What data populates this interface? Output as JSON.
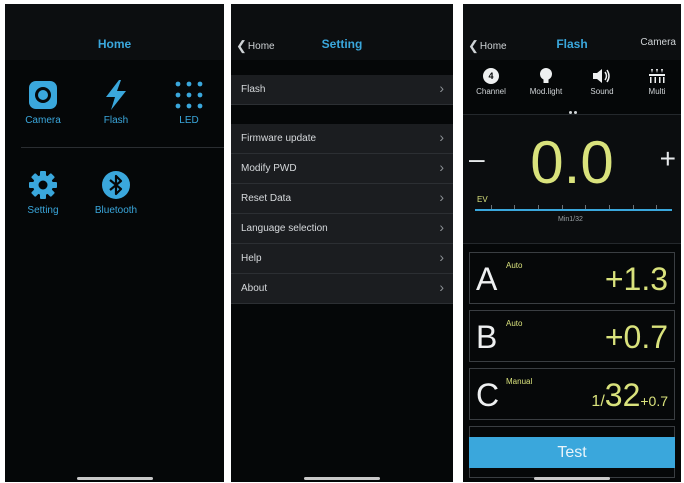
{
  "screen_home": {
    "title": "Home",
    "tiles": [
      {
        "label": "Camera",
        "icon": "camera-icon"
      },
      {
        "label": "Flash",
        "icon": "flash-icon"
      },
      {
        "label": "LED",
        "icon": "led-grid-icon"
      },
      {
        "label": "Setting",
        "icon": "gear-icon"
      },
      {
        "label": "Bluetooth",
        "icon": "bluetooth-icon"
      }
    ]
  },
  "screen_setting": {
    "back_label": "Home",
    "title": "Setting",
    "items": [
      {
        "label": "Flash"
      },
      {
        "label": "Firmware update"
      },
      {
        "label": "Modify PWD"
      },
      {
        "label": "Reset Data"
      },
      {
        "label": "Language selection"
      },
      {
        "label": "Help"
      },
      {
        "label": "About"
      }
    ]
  },
  "screen_flash": {
    "back_label": "Home",
    "title": "Flash",
    "right_label": "Camera",
    "modes": [
      {
        "label": "Channel",
        "badge": "4",
        "icon": "channel-icon"
      },
      {
        "label": "Mod.light",
        "icon": "bulb-icon"
      },
      {
        "label": "Sound",
        "icon": "speaker-icon"
      },
      {
        "label": "Multi",
        "icon": "multi-icon"
      }
    ],
    "ev": {
      "value": "0.0",
      "minus": "–",
      "plus": "+",
      "unit_label": "EV",
      "min_label": "Min1/32"
    },
    "channels": [
      {
        "letter": "A",
        "mode": "Auto",
        "value": "+1.3"
      },
      {
        "letter": "B",
        "mode": "Auto",
        "value": "+0.7"
      },
      {
        "letter": "C",
        "mode": "Manual",
        "value_prefix": "1/",
        "value_main": "32",
        "value_suffix": "+0.7"
      }
    ],
    "test_label": "Test"
  },
  "colors": {
    "accent": "#3aa7dc",
    "value_yellow": "#d9e27c",
    "background": "#050708"
  }
}
